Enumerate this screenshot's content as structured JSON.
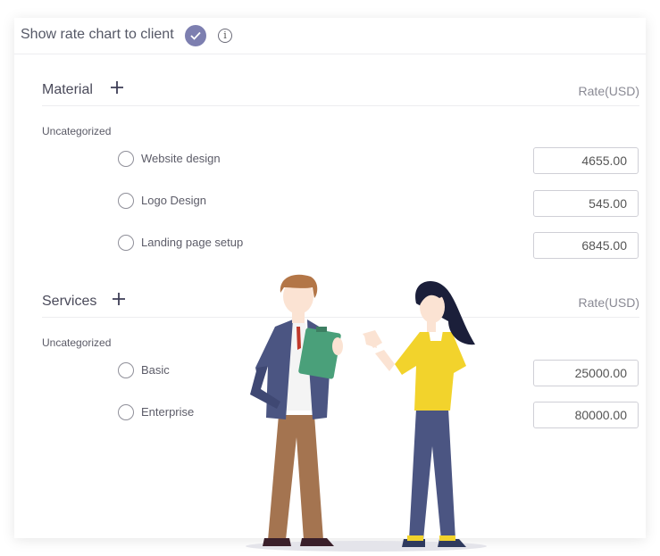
{
  "header": {
    "title": "Show rate chart to client"
  },
  "sections": [
    {
      "title": "Material",
      "rate_label": "Rate(USD)",
      "category": "Uncategorized",
      "items": [
        {
          "label": "Website design",
          "rate": "4655.00"
        },
        {
          "label": "Logo Design",
          "rate": "545.00"
        },
        {
          "label": "Landing page setup",
          "rate": "6845.00"
        }
      ]
    },
    {
      "title": "Services",
      "rate_label": "Rate(USD)",
      "category": "Uncategorized",
      "items": [
        {
          "label": "Basic",
          "rate": "25000.00"
        },
        {
          "label": "Enterprise",
          "rate": "80000.00"
        }
      ]
    }
  ],
  "colors": {
    "accent": "#7d7fb0",
    "shirt_yellow": "#f2d32c",
    "clipboard_green": "#4aa07a"
  },
  "icons": [
    "check-icon",
    "info-icon",
    "plus-icon",
    "radio-icon"
  ]
}
